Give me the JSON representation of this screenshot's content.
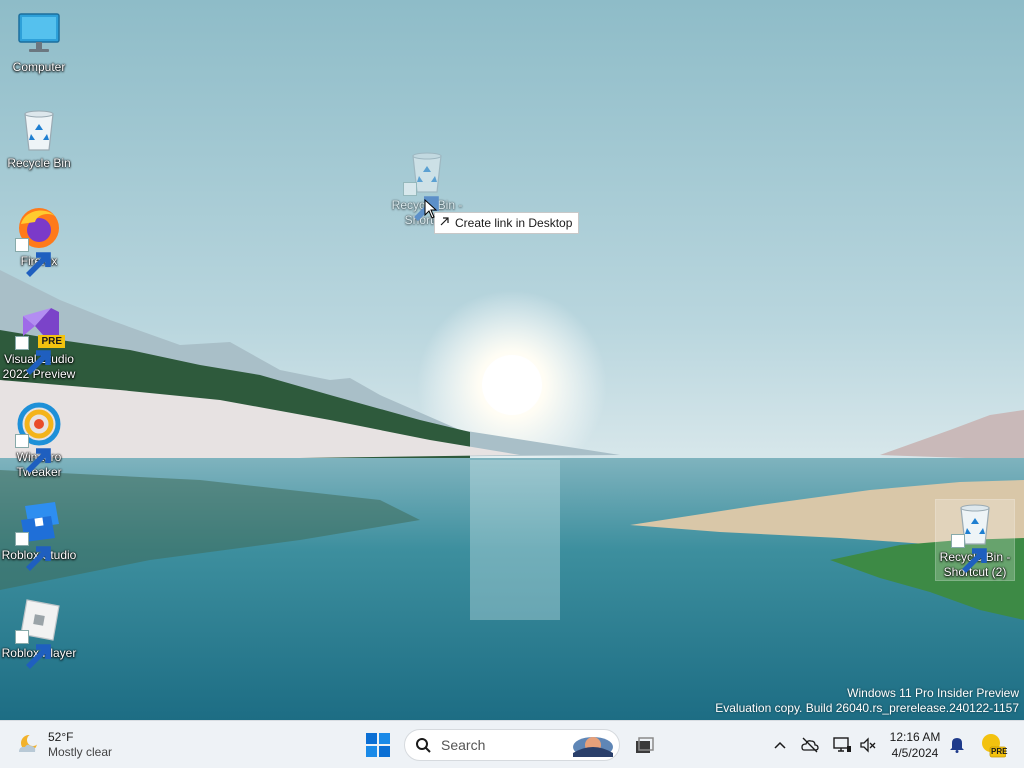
{
  "desktop": {
    "icons": [
      {
        "label": "Computer",
        "icon": "monitor-icon"
      },
      {
        "label": "Recycle Bin",
        "icon": "recycle-bin-icon"
      },
      {
        "label": "Firefox",
        "icon": "firefox-icon"
      },
      {
        "label": "Visual Studio 2022 Preview",
        "icon": "visual-studio-icon",
        "badge": "PRE"
      },
      {
        "label": "Winaero Tweaker",
        "icon": "winaero-tweaker-icon"
      },
      {
        "label": "Roblox Studio",
        "icon": "roblox-studio-icon"
      },
      {
        "label": "Roblox Player",
        "icon": "roblox-player-icon"
      }
    ],
    "dragged_shortcut": {
      "label": "Recycle Bin - Shortcut",
      "icon": "recycle-bin-icon"
    },
    "corner_shortcut": {
      "label": "Recycle Bin - Shortcut (2)",
      "icon": "recycle-bin-icon"
    },
    "drag_tooltip": {
      "text": "Create link in Desktop",
      "icon": "shortcut-arrow-icon"
    }
  },
  "watermark": {
    "line1": "Windows 11 Pro Insider Preview",
    "line2": "Evaluation copy. Build 26040.rs_prerelease.240122-1157"
  },
  "taskbar": {
    "weather": {
      "temperature": "52°F",
      "condition": "Mostly clear",
      "icon": "moon-cloud-icon"
    },
    "search_label": "Search",
    "clock": {
      "time": "12:16 AM",
      "date": "4/5/2024"
    },
    "pre_badge": "PRE",
    "tray_icons": [
      "chevron-up-icon",
      "onedrive-offline-icon",
      "network-icon",
      "volume-muted-icon",
      "bell-icon"
    ]
  },
  "colors": {
    "accent": "#0067c0",
    "taskbar_bg": "#eef2f6",
    "vs_purple": "#8a4fd6",
    "pre_badge": "#f3c20f"
  }
}
